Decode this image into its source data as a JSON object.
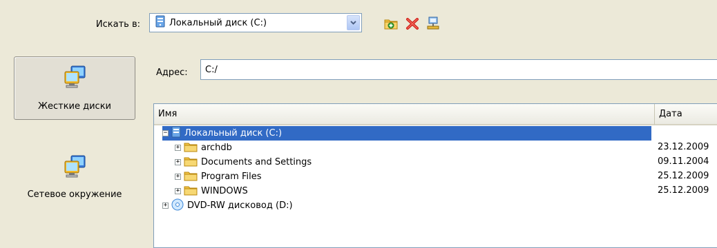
{
  "look_in": {
    "label": "Искать в:",
    "selected": "Локальный диск (C:)"
  },
  "toolbar": {
    "icons": [
      "new-folder-icon",
      "delete-icon",
      "map-network-drive-icon"
    ]
  },
  "places": [
    {
      "label": "Жесткие диски",
      "icon": "computer-icon",
      "selected": true
    },
    {
      "label": "Сетевое окружение",
      "icon": "network-computer-icon",
      "selected": false
    }
  ],
  "address": {
    "label": "Адрес:",
    "value": "C:/"
  },
  "tree": {
    "columns": [
      "Имя",
      "Дата"
    ],
    "rows": [
      {
        "name": "Локальный диск (C:)",
        "date": "",
        "type": "drive",
        "expanded": true,
        "selected": true
      },
      {
        "name": "archdb",
        "date": "23.12.2009",
        "type": "folder",
        "expanded": false,
        "selected": false
      },
      {
        "name": "Documents and Settings",
        "date": "09.11.2004",
        "type": "folder",
        "expanded": false,
        "selected": false
      },
      {
        "name": "Program Files",
        "date": "25.12.2009",
        "type": "folder",
        "expanded": false,
        "selected": false
      },
      {
        "name": "WINDOWS",
        "date": "25.12.2009",
        "type": "folder",
        "expanded": false,
        "selected": false
      },
      {
        "name": "DVD-RW дисковод (D:)",
        "date": "",
        "type": "dvd",
        "expanded": false,
        "selected": false
      }
    ]
  },
  "colors": {
    "background": "#ece9d8",
    "selection": "#316ac5",
    "border": "#7f9db9"
  }
}
